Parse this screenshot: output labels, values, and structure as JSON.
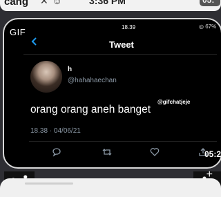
{
  "chat": {
    "sender_partial": "cang",
    "emojis": "✕ ☺",
    "time": "3:36 PM",
    "time_right_partial": "05:"
  },
  "gif": {
    "badge": "GIF"
  },
  "tweet_screen": {
    "status_time": "18.39",
    "status_battery": "◎ 67%",
    "nav_title": "Tweet",
    "author": {
      "display_name": "h",
      "handle": "@hahahaechan"
    },
    "watermark": "@gifchatjeje",
    "text": "orang orang aneh banget",
    "meta": "18.38 · 04/06/21",
    "actions": [
      "reply-icon",
      "retweet-icon",
      "like-icon",
      "share-icon"
    ]
  },
  "overlay": {
    "time_bottom_partial": "05:2"
  },
  "colors": {
    "accent": "#1d9bf0",
    "tweet_bg": "#000000",
    "muted": "#8b98a5"
  }
}
